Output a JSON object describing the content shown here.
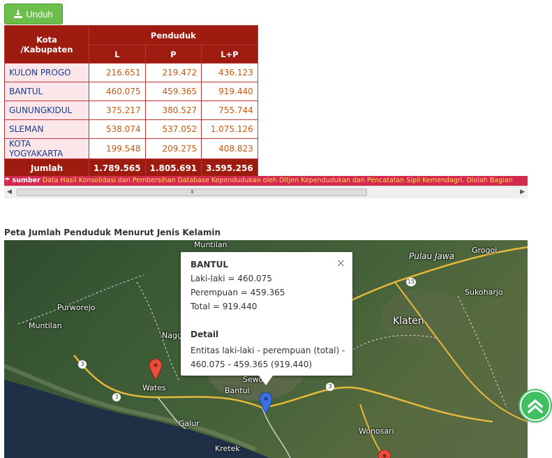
{
  "download_button": {
    "label": "Unduh",
    "icon": "download-icon"
  },
  "table": {
    "header_kota": "Kota /Kabupaten",
    "header_penduduk": "Penduduk",
    "col_l": "L",
    "col_p": "P",
    "col_lp": "L+P",
    "rows": [
      {
        "kota": "KULON PROGO",
        "l": "216.651",
        "p": "219.472",
        "lp": "436.123"
      },
      {
        "kota": "BANTUL",
        "l": "460.075",
        "p": "459.365",
        "lp": "919.440"
      },
      {
        "kota": "GUNUNGKIDUL",
        "l": "375.217",
        "p": "380.527",
        "lp": "755.744"
      },
      {
        "kota": "SLEMAN",
        "l": "538.074",
        "p": "537.052",
        "lp": "1.075.126"
      },
      {
        "kota": "KOTA YOGYAKARTA",
        "l": "199.548",
        "p": "209.275",
        "lp": "408.823"
      }
    ],
    "total": {
      "label": "Jumlah",
      "l": "1.789.565",
      "p": "1.805.691",
      "lp": "3.595.256"
    }
  },
  "sumber": {
    "label": "sumber",
    "text": "Data Hasil Konsolidasi dan Pembersihan Database Kependudukan oleh Ditjen Kependudukan dan Pencatatan Sipil Kemendagri. Diolah Bagian"
  },
  "scrollbar": {
    "grip": "III"
  },
  "map": {
    "title": "Peta Jumlah Penduduk Menurut Jenis Kelamin",
    "labels": {
      "muntilan_top": "Muntilan",
      "grogol": "Grogol",
      "pulau_jawa": "Pulau Jawa",
      "purworejo": "Purworejo",
      "sukoharjo": "Sukoharjo",
      "muntilan_left": "Muntilan",
      "klaten": "Klaten",
      "nagg": "Nagg",
      "wates": "Wates",
      "sewo": "Sewo",
      "bantul": "Bantul",
      "galur": "Galur",
      "wonosari": "Wonosari",
      "kretek": "Kretek",
      "road_3a": "3",
      "road_3b": "3",
      "road_3c": "3",
      "road_15": "15"
    },
    "popup": {
      "title": "BANTUL",
      "laki": "Laki-laki = 460.075",
      "perempuan": "Perempuan = 459.365",
      "total": "Total = 919.440",
      "detail_title": "Detail",
      "detail_text": "Entitas laki-laki - perempuan (total) - 460.075 - 459.365 (919.440)",
      "close": "×"
    },
    "colors": {
      "pin_red": "#e74c3c",
      "pin_blue": "#3b6fe0"
    }
  },
  "scroll_top": {
    "icon": "double-chevron-up-icon"
  }
}
